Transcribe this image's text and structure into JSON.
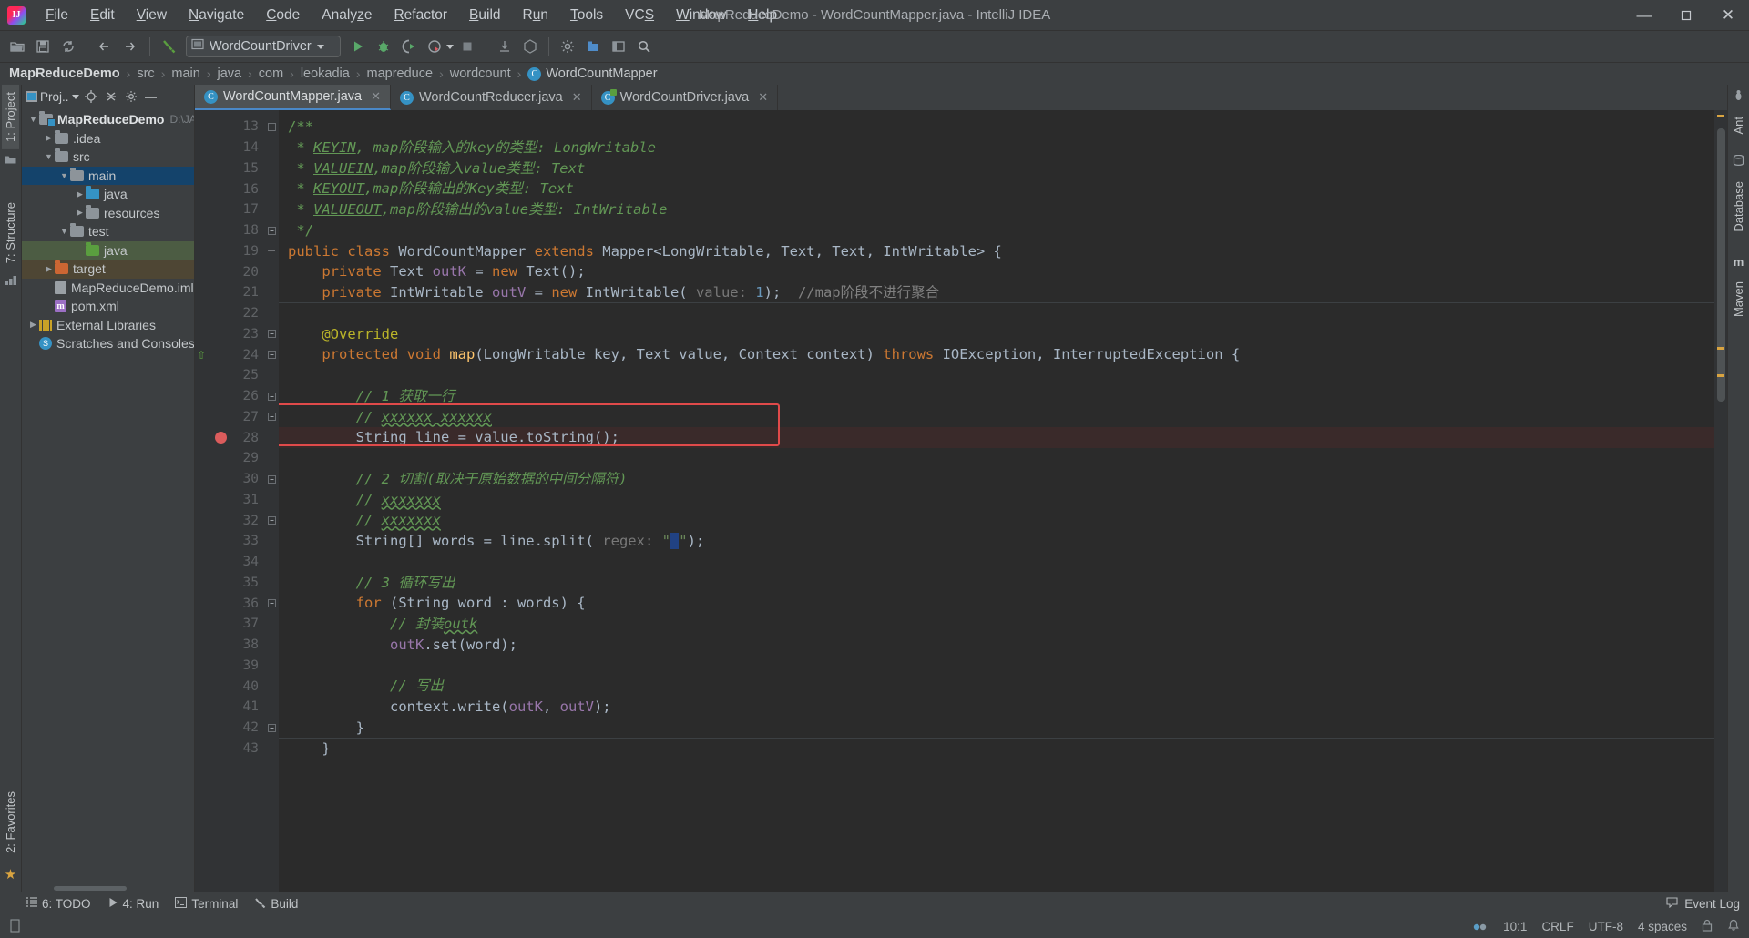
{
  "window": {
    "title": "MapReduceDemo - WordCountMapper.java - IntelliJ IDEA",
    "minimize": "—",
    "maximize": "❐",
    "close": "✕"
  },
  "menubar": [
    {
      "label": "File",
      "mnemonic": "F"
    },
    {
      "label": "Edit",
      "mnemonic": "E"
    },
    {
      "label": "View",
      "mnemonic": "V"
    },
    {
      "label": "Navigate",
      "mnemonic": "N"
    },
    {
      "label": "Code",
      "mnemonic": "C"
    },
    {
      "label": "Analyze",
      "mnemonic": "z"
    },
    {
      "label": "Refactor",
      "mnemonic": "R"
    },
    {
      "label": "Build",
      "mnemonic": "B"
    },
    {
      "label": "Run",
      "mnemonic": "u"
    },
    {
      "label": "Tools",
      "mnemonic": "T"
    },
    {
      "label": "VCS",
      "mnemonic": "S"
    },
    {
      "label": "Window",
      "mnemonic": "W"
    },
    {
      "label": "Help",
      "mnemonic": "H"
    }
  ],
  "toolbar": {
    "run_config": "WordCountDriver",
    "icons": [
      "open-folder-icon",
      "save-all-icon",
      "sync-icon",
      "back-icon",
      "forward-icon",
      "build-hammer-icon"
    ],
    "run_icons": [
      "run-icon",
      "debug-icon",
      "run-coverage-icon",
      "profiler-icon",
      "stop-icon"
    ],
    "right_icons": [
      "update-project-icon",
      "commit-icon",
      "settings-icon",
      "project-structure-icon",
      "layout-icon",
      "search-icon"
    ]
  },
  "breadcrumb": {
    "items": [
      "MapReduceDemo",
      "src",
      "main",
      "java",
      "com",
      "leokadia",
      "mapreduce",
      "wordcount"
    ],
    "class": "WordCountMapper",
    "separator": "›"
  },
  "project_panel": {
    "title": "Proj..",
    "header_icons": [
      "project-view-icon",
      "locate-icon",
      "collapse-all-icon",
      "settings-gear-icon",
      "hide-icon"
    ],
    "tree": [
      {
        "label": "MapReduceDemo",
        "suffix": "D:\\JA",
        "depth": 0,
        "arrow": "▼",
        "icon": "module-folder",
        "bold": true,
        "sel": ""
      },
      {
        "label": ".idea",
        "depth": 1,
        "arrow": "▶",
        "icon": "folder",
        "sel": ""
      },
      {
        "label": "src",
        "depth": 1,
        "arrow": "▼",
        "icon": "folder",
        "sel": ""
      },
      {
        "label": "main",
        "depth": 2,
        "arrow": "▼",
        "icon": "folder",
        "sel": "sel-blue"
      },
      {
        "label": "java",
        "depth": 3,
        "arrow": "▶",
        "icon": "folder-blue",
        "sel": ""
      },
      {
        "label": "resources",
        "depth": 3,
        "arrow": "▶",
        "icon": "folder-res",
        "sel": ""
      },
      {
        "label": "test",
        "depth": 2,
        "arrow": "▼",
        "icon": "folder",
        "sel": ""
      },
      {
        "label": "java",
        "depth": 3,
        "arrow": "",
        "icon": "folder-green",
        "sel": "sel-green"
      },
      {
        "label": "target",
        "depth": 1,
        "arrow": "▶",
        "icon": "folder-orange",
        "sel": "sel-brown"
      },
      {
        "label": "MapReduceDemo.iml",
        "depth": 1,
        "arrow": "",
        "icon": "file",
        "sel": ""
      },
      {
        "label": "pom.xml",
        "depth": 1,
        "arrow": "",
        "icon": "maven",
        "sel": ""
      },
      {
        "label": "External Libraries",
        "depth": 0,
        "arrow": "▶",
        "icon": "library",
        "sel": ""
      },
      {
        "label": "Scratches and Consoles",
        "depth": 0,
        "arrow": "",
        "icon": "scratch",
        "sel": ""
      }
    ]
  },
  "left_strip": {
    "top_tab": "1: Project",
    "bottom_tab": "2: Favorites",
    "structure_tab": "7: Structure"
  },
  "right_strip": {
    "tabs": [
      "Ant",
      "Database",
      "Maven"
    ]
  },
  "editor_tabs": [
    {
      "label": "WordCountMapper.java",
      "icon": "java-class-icon",
      "active": true,
      "close": "✕"
    },
    {
      "label": "WordCountReducer.java",
      "icon": "java-class-icon",
      "active": false,
      "close": "✕"
    },
    {
      "label": "WordCountDriver.java",
      "icon": "java-runnable-class-icon",
      "active": false,
      "close": "✕"
    }
  ],
  "code": {
    "first_line_number": 13,
    "lines": [
      {
        "n": 13,
        "html": "<span class=\"cmt-doc\">/**</span>"
      },
      {
        "n": 14,
        "html": "<span class=\"cmt-doc\"> * </span><span class=\"doctag\">KEYIN</span><span class=\"doct\">, map阶段输入的key的类型: LongWritable</span>"
      },
      {
        "n": 15,
        "html": "<span class=\"cmt-doc\"> * </span><span class=\"doctag\">VALUEIN</span><span class=\"doct\">,map阶段输入value类型: Text</span>"
      },
      {
        "n": 16,
        "html": "<span class=\"cmt-doc\"> * </span><span class=\"doctag\">KEYOUT</span><span class=\"doct\">,map阶段输出的Key类型: Text</span>"
      },
      {
        "n": 17,
        "html": "<span class=\"cmt-doc\"> * </span><span class=\"doctag\">VALUEOUT</span><span class=\"doct\">,map阶段输出的value类型: IntWritable</span>"
      },
      {
        "n": 18,
        "html": "<span class=\"cmt-doc\"> */</span>"
      },
      {
        "n": 19,
        "html": "<span class=\"kw\">public class </span><span class=\"typ\">WordCountMapper </span><span class=\"kw\">extends </span><span class=\"typ\">Mapper&lt;LongWritable, Text, Text, IntWritable&gt; {</span>"
      },
      {
        "n": 20,
        "html": "    <span class=\"kw\">private </span><span class=\"typ\">Text </span><span class=\"fld\">outK </span><span class=\"typ\">= </span><span class=\"kw\">new </span><span class=\"typ\">Text();</span>"
      },
      {
        "n": 21,
        "html": "    <span class=\"kw\">private </span><span class=\"typ\">IntWritable </span><span class=\"fld\">outV </span><span class=\"typ\">= </span><span class=\"kw\">new </span><span class=\"typ\">IntWritable(</span><span class=\"hint\"> value: </span><span class=\"num\">1</span><span class=\"typ\">);  </span><span class=\"cmt-ln\">//map阶段不进行聚合</span>"
      },
      {
        "n": 22,
        "html": ""
      },
      {
        "n": 23,
        "html": "    <span class=\"anno\">@Override</span>"
      },
      {
        "n": 24,
        "html": "    <span class=\"kw\">protected void </span><span class=\"mthd\">map</span><span class=\"typ\">(LongWritable key, Text value, Context context) </span><span class=\"kw\">throws </span><span class=\"typ\">IOException, InterruptedException {</span>"
      },
      {
        "n": 25,
        "html": ""
      },
      {
        "n": 26,
        "html": "        <span class=\"cmt\">// 1 获取一行</span>"
      },
      {
        "n": 27,
        "html": "        <span class=\"cmt\">// </span><span class=\"cmt wavy\">xxxxxx xxxxxx</span>"
      },
      {
        "n": 28,
        "html": "        <span class=\"typ\">String line = value.toString();</span>",
        "highlight": true
      },
      {
        "n": 29,
        "html": ""
      },
      {
        "n": 30,
        "html": "        <span class=\"cmt\">// 2 切割(取决于原始数据的中间分隔符)</span>"
      },
      {
        "n": 31,
        "html": "        <span class=\"cmt\">// </span><span class=\"cmt wavy\">xxxxxxx</span>"
      },
      {
        "n": 32,
        "html": "        <span class=\"cmt\">// </span><span class=\"cmt wavy\">xxxxxxx</span>"
      },
      {
        "n": 33,
        "html": "        <span class=\"typ\">String[] words = line.split(</span><span class=\"hint\"> regex: </span><span class=\"str\">\"</span><span class=\"caretbox\">&nbsp;</span><span class=\"str\">\"</span><span class=\"typ\">);</span>"
      },
      {
        "n": 34,
        "html": ""
      },
      {
        "n": 35,
        "html": "        <span class=\"cmt\">// 3 循环写出</span>"
      },
      {
        "n": 36,
        "html": "        <span class=\"kw\">for </span><span class=\"typ\">(String word : words) {</span>"
      },
      {
        "n": 37,
        "html": "            <span class=\"cmt\">// 封装</span><span class=\"cmt wavy\">outk</span>"
      },
      {
        "n": 38,
        "html": "            <span class=\"fld\">outK</span><span class=\"typ\">.set(word);</span>"
      },
      {
        "n": 39,
        "html": ""
      },
      {
        "n": 40,
        "html": "            <span class=\"cmt\">// 写出</span>"
      },
      {
        "n": 41,
        "html": "            <span class=\"typ\">context.write(</span><span class=\"fld\">outK</span><span class=\"typ\">, </span><span class=\"fld\">outV</span><span class=\"typ\">);</span>"
      },
      {
        "n": 42,
        "html": "        <span class=\"typ\">}</span>"
      },
      {
        "n": 43,
        "html": "    <span class=\"typ\">}</span>"
      }
    ],
    "breakpoint_line": 28,
    "highlight_box_line": 27
  },
  "bottom_bar": {
    "items": [
      {
        "label": "6: TODO",
        "mnemonic": "6",
        "icon": "todo-icon"
      },
      {
        "label": "4: Run",
        "mnemonic": "4",
        "icon": "run-icon"
      },
      {
        "label": "Terminal",
        "mnemonic": "",
        "icon": "terminal-icon"
      },
      {
        "label": "Build",
        "mnemonic": "",
        "icon": "build-icon"
      }
    ],
    "event_log": "Event Log"
  },
  "status_bar": {
    "caret_position": "10:1",
    "line_separator": "CRLF",
    "encoding": "UTF-8",
    "indent": "4 spaces",
    "icons": [
      "inspections-icon",
      "lock-icon",
      "notification-icon"
    ]
  }
}
